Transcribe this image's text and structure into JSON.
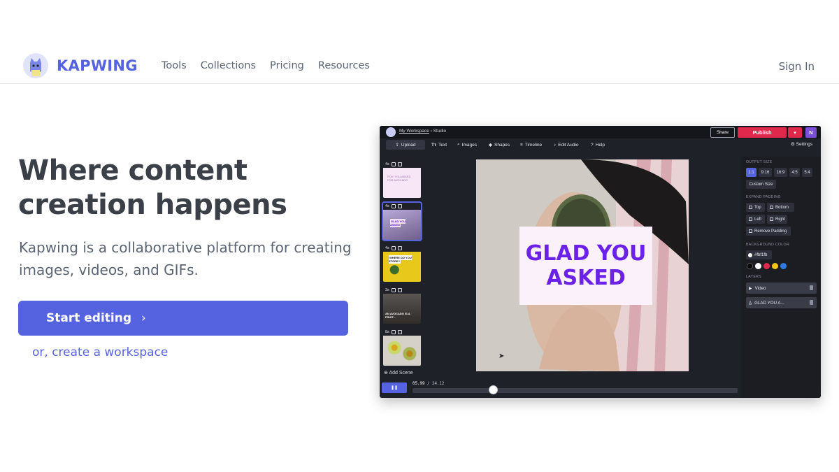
{
  "nav": {
    "logo_text": "KAPWING",
    "links": [
      "Tools",
      "Collections",
      "Pricing",
      "Resources"
    ],
    "sign_in": "Sign In"
  },
  "hero": {
    "headline": "Where content creation happens",
    "subtext": "Kapwing is a collaborative platform for creating images, videos, and GIFs.",
    "cta": "Start editing",
    "secondary_link": "or, create a workspace"
  },
  "editor": {
    "breadcrumb_workspace": "My Workspace",
    "breadcrumb_sep": "›",
    "breadcrumb_page": "Studio",
    "share": "Share",
    "publish": "Publish",
    "user_initial": "N",
    "toolbar": {
      "upload": "Upload",
      "text": "Text",
      "images": "Images",
      "shapes": "Shapes",
      "timeline": "Timeline",
      "edit_audio": "Edit Audio",
      "help": "Help",
      "settings": "Settings"
    },
    "scenes": [
      {
        "duration": "4s",
        "thumb_color": "#f7e6f5",
        "caption": "POV: YOU ASKED FOR AVOCADO"
      },
      {
        "duration": "4s",
        "thumb_color": "#c9b9e4",
        "caption": "GLAD YOU ASKED"
      },
      {
        "duration": "4s",
        "thumb_color": "#e8c81b",
        "caption": "WHERE DO YOU STORE?"
      },
      {
        "duration": "3s",
        "thumb_color": "#6f6a66",
        "caption": "AN AVOCADO IS A FRUIT..."
      },
      {
        "duration": "8s",
        "thumb_color": "#d5d1c9",
        "caption": ""
      }
    ],
    "add_scene": "Add Scene",
    "canvas_text_line1": "GLAD YOU",
    "canvas_text_line2": "ASKED",
    "panel": {
      "output_size_label": "OUTPUT SIZE",
      "ratios": [
        "1:1",
        "9:16",
        "16:9",
        "4:5",
        "5:4"
      ],
      "selected_ratio": "1:1",
      "custom_size": "Custom Size",
      "expand_padding_label": "EXPAND PADDING",
      "padding_options": [
        "Top",
        "Bottom",
        "Left",
        "Right"
      ],
      "remove_padding": "Remove Padding",
      "background_color_label": "BACKGROUND COLOR",
      "background_color_value": "#fbf1fb",
      "swatches": [
        "#000000",
        "#ffffff",
        "#e0284c",
        "#f5c518",
        "#2d7be0"
      ],
      "layers_label": "LAYERS",
      "layers": [
        "Video",
        "GLAD YOU A..."
      ]
    },
    "playback": {
      "current_time": "05.99",
      "separator": "/",
      "total_time": "24.12",
      "progress": 0.248
    }
  },
  "colors": {
    "brand": "#5563e0",
    "publish": "#e0284c",
    "canvas_text": "#6b21e8"
  }
}
